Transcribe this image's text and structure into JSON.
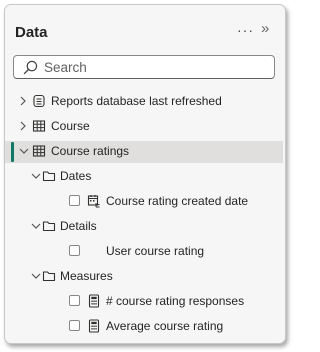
{
  "pane": {
    "title": "Data",
    "more_label": "···",
    "collapse_label": "»",
    "search": {
      "placeholder": "Search",
      "value": ""
    }
  },
  "tree": {
    "reports_table": "Reports database last refreshed",
    "course_table": "Course",
    "course_ratings_table": "Course ratings",
    "dates_folder": "Dates",
    "created_date_field": "Course rating created date",
    "details_folder": "Details",
    "user_rating_field": "User course rating",
    "measures_folder": "Measures",
    "responses_measure": "# course rating responses",
    "average_measure": "Average course rating"
  },
  "colors": {
    "accent": "#117865",
    "selected_row": "#e1dfdd"
  }
}
